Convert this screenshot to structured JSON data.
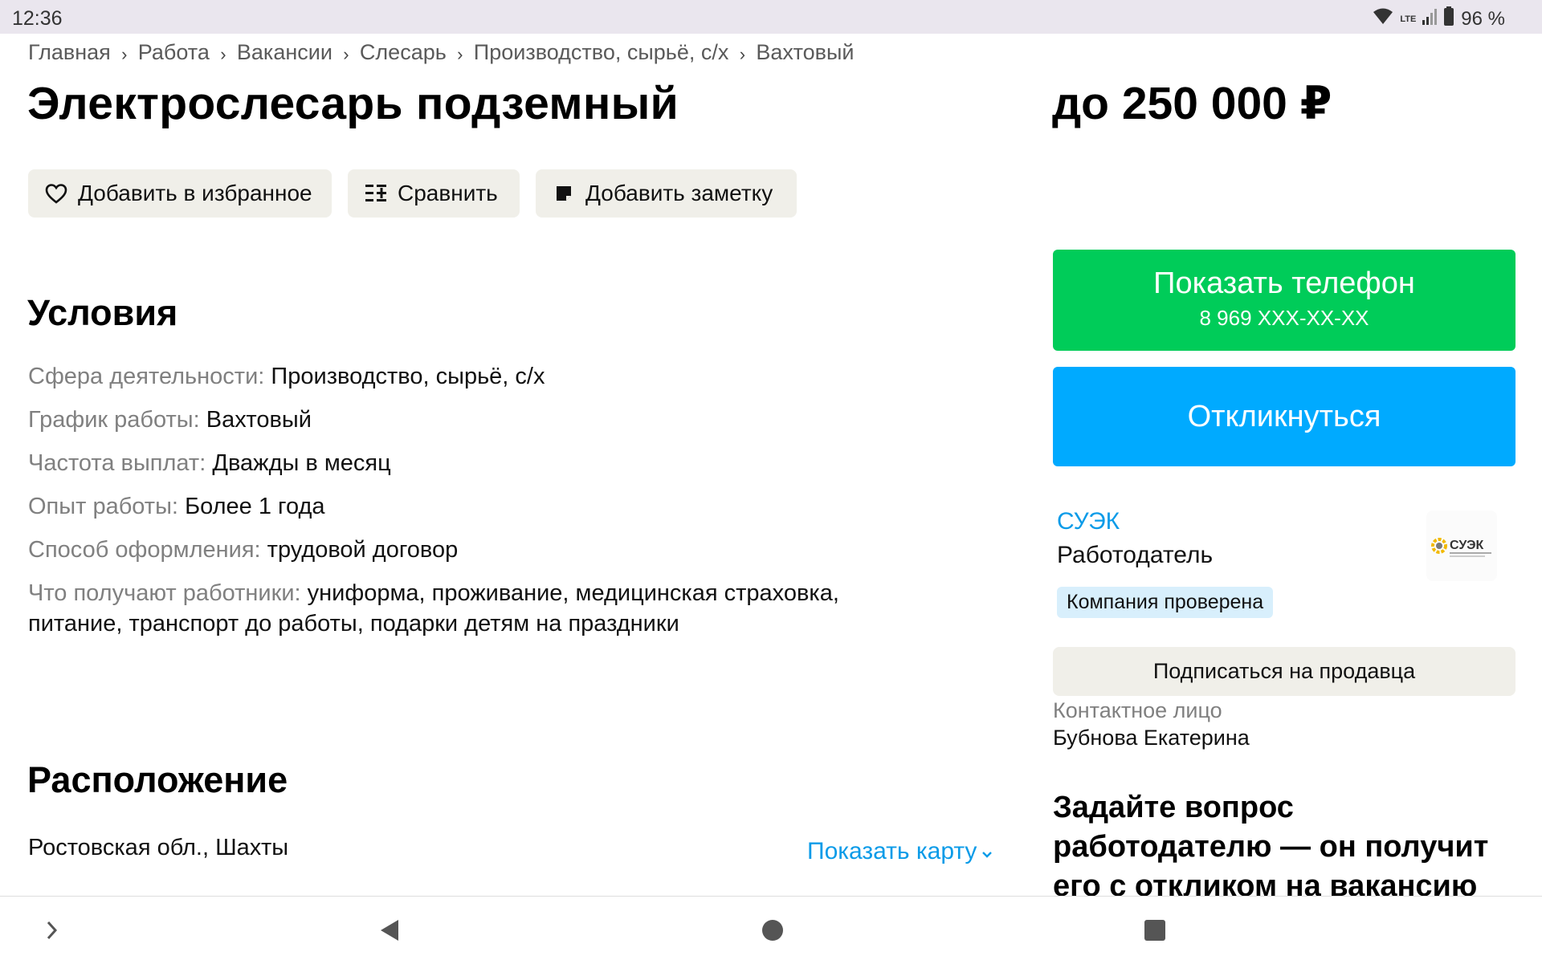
{
  "status_bar": {
    "time": "12:36",
    "network": "LTE",
    "battery": "96 %"
  },
  "breadcrumb": [
    "Главная",
    "Работа",
    "Вакансии",
    "Слесарь",
    "Производство, сырьё, с/х",
    "Вахтовый"
  ],
  "title": "Электрослесарь подземный",
  "salary": "до 250 000 ₽",
  "actions": {
    "favorite": "Добавить в избранное",
    "compare": "Сравнить",
    "note": "Добавить заметку"
  },
  "conditions": {
    "heading": "Условия",
    "rows": [
      {
        "label": "Сфера деятельности:",
        "value": "Производство, сырьё, с/х"
      },
      {
        "label": "График работы:",
        "value": "Вахтовый"
      },
      {
        "label": "Частота выплат:",
        "value": "Дважды в месяц"
      },
      {
        "label": "Опыт работы:",
        "value": "Более 1 года"
      },
      {
        "label": "Способ оформления:",
        "value": "трудовой договор"
      },
      {
        "label": "Что получают работники:",
        "value": "униформа, проживание, медицинская страховка, питание, транспорт до работы, подарки детям на праздники"
      }
    ]
  },
  "location": {
    "heading": "Расположение",
    "address": "Ростовская обл., Шахты",
    "show_map": "Показать карту"
  },
  "sidebar": {
    "phone_button": {
      "label": "Показать телефон",
      "number": "8 969 XXX-XX-XX"
    },
    "respond_button": "Откликнуться",
    "company": {
      "name": "СУЭК",
      "role": "Работодатель",
      "verified": "Компания проверена",
      "logo_text": "СУЭК"
    },
    "subscribe_button": "Подписаться на продавца",
    "contact_label": "Контактное лицо",
    "contact_name": "Бубнова Екатерина",
    "ask_heading": "Задайте вопрос работодателю — он получит его с откликом на вакансию"
  },
  "colors": {
    "green": "#00cc59",
    "blue": "#00aaff",
    "link": "#0a9be8",
    "button_bg": "#f0efe9",
    "badge_bg": "#d8effc"
  }
}
